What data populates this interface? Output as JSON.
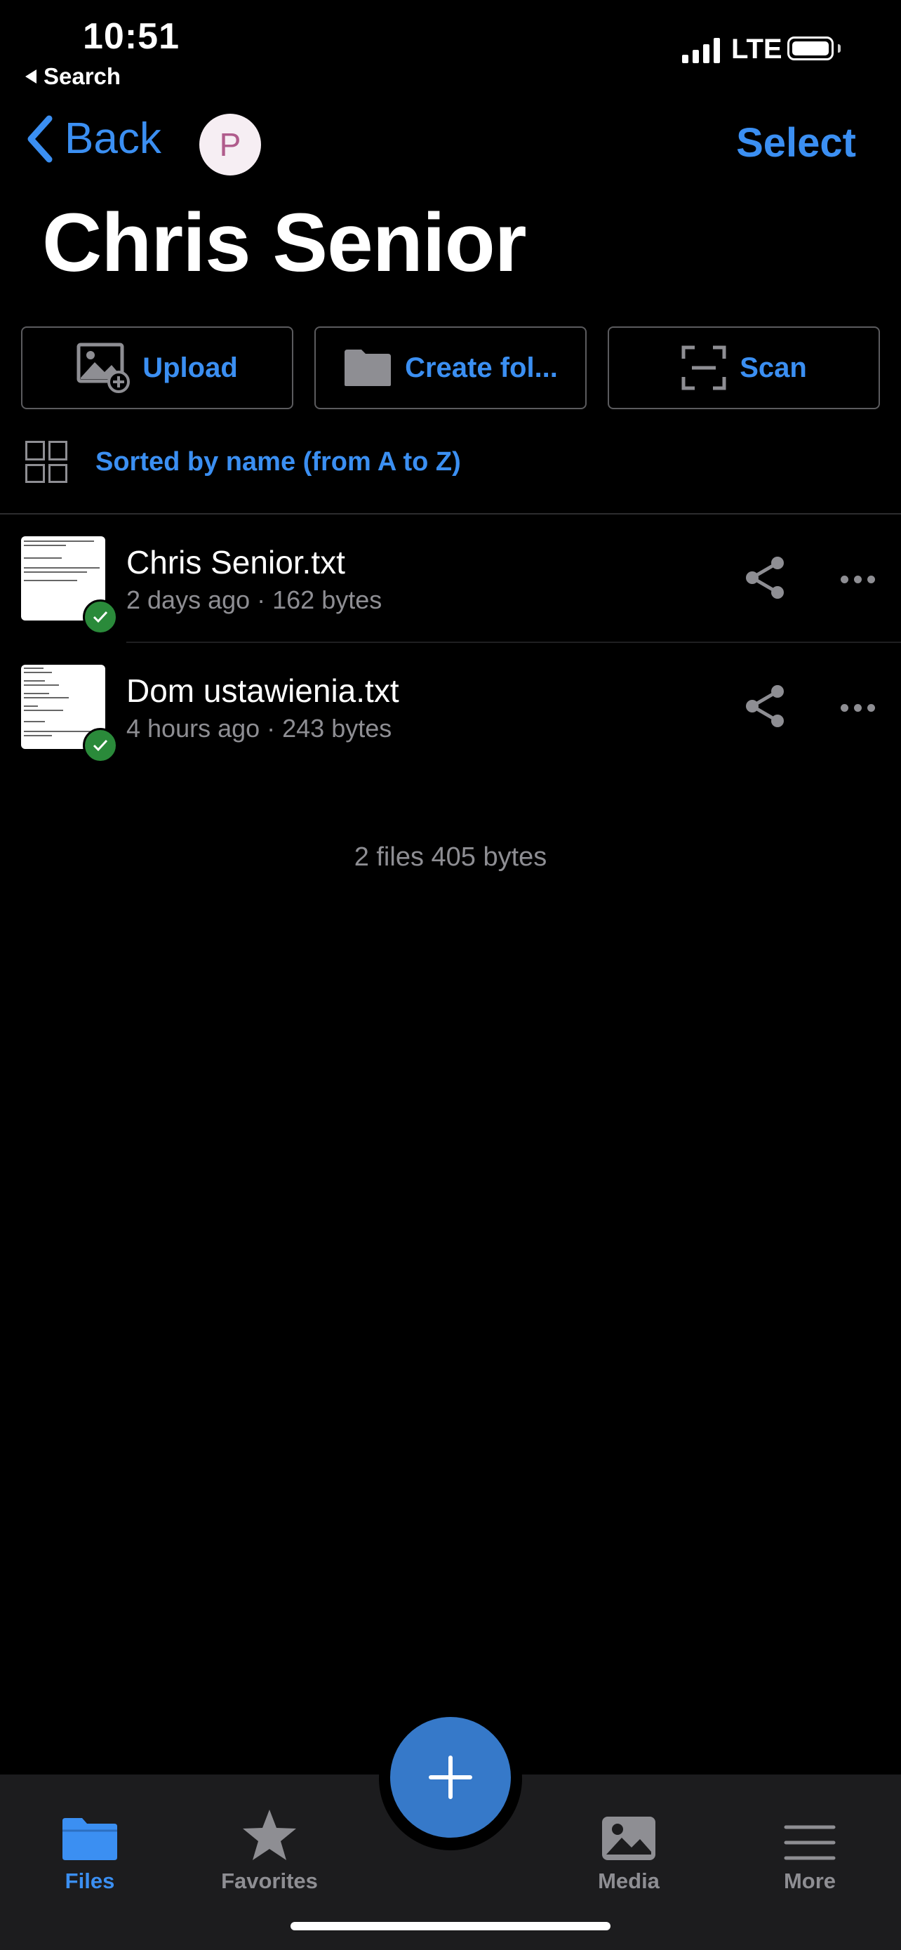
{
  "status_bar": {
    "time": "10:51",
    "back_app": "Search",
    "network": "LTE"
  },
  "nav": {
    "back_label": "Back",
    "avatar_initial": "P",
    "select_label": "Select"
  },
  "page": {
    "title": "Chris Senior"
  },
  "actions": [
    {
      "label": "Upload",
      "icon": "image-add-icon"
    },
    {
      "label": "Create fol...",
      "icon": "folder-icon"
    },
    {
      "label": "Scan",
      "icon": "scan-icon"
    }
  ],
  "sort": {
    "label": "Sorted by name (from A to Z)"
  },
  "files": [
    {
      "name": "Chris Senior.txt",
      "meta": "2 days ago · 162 bytes",
      "synced": true
    },
    {
      "name": "Dom ustawienia.txt",
      "meta": "4 hours ago · 243 bytes",
      "synced": true
    }
  ],
  "summary": "2 files 405 bytes",
  "tabbar": {
    "tabs": [
      {
        "label": "Files",
        "icon": "folder-icon",
        "active": true
      },
      {
        "label": "Favorites",
        "icon": "star-icon",
        "active": false
      },
      {
        "label": "Media",
        "icon": "photo-icon",
        "active": false
      },
      {
        "label": "More",
        "icon": "menu-icon",
        "active": false
      }
    ]
  },
  "colors": {
    "accent": "#3b8ff2",
    "fab": "#3679c9",
    "synced": "#2a8a3a",
    "background": "#000000",
    "tabbar": "#1c1c1e",
    "secondary_text": "#8e8e93"
  }
}
